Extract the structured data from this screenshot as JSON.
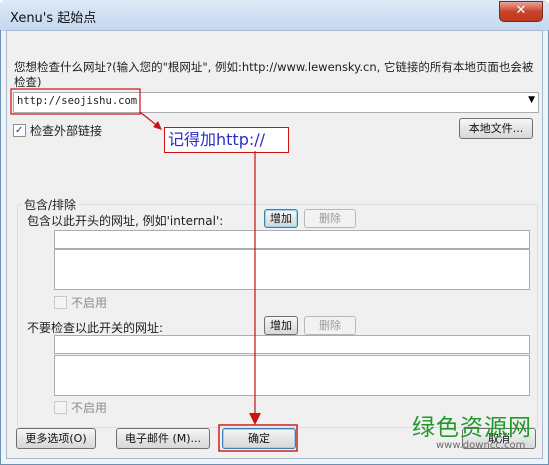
{
  "window": {
    "title": "Xenu's 起始点",
    "close_glyph": "✕"
  },
  "intro": {
    "text": "您想检查什么网址?(输入您的\"根网址\", 例如:http://www.lewensky.cn, 它链接的所有本地页面也会被检查)"
  },
  "url_combo": {
    "value": "http://seojishu.com"
  },
  "check_external": {
    "label": "检查外部链接",
    "checked": true
  },
  "local_file_button": "本地文件...",
  "hint": {
    "text": "记得加http://"
  },
  "include_exclude": {
    "group_label": "包含/排除",
    "include_label": "包含以此开头的网址, 例如'internal':",
    "include_add": "增加",
    "include_delete": "删除",
    "include_disable": "不启用",
    "exclude_label": "不要检查以此开关的网址:",
    "exclude_add": "增加",
    "exclude_delete": "删除",
    "exclude_disable": "不启用"
  },
  "buttons": {
    "more_options": "更多选项(O)",
    "email": "电子邮件 (M)...",
    "ok": "确定",
    "cancel": "取消"
  },
  "watermark": {
    "main": "绿色资源网",
    "sub": "www.downcc.com"
  },
  "colors": {
    "annotation_red": "#cc1111",
    "hint_blue": "#2c2cc8",
    "watermark_green": "#1f9a2a"
  }
}
